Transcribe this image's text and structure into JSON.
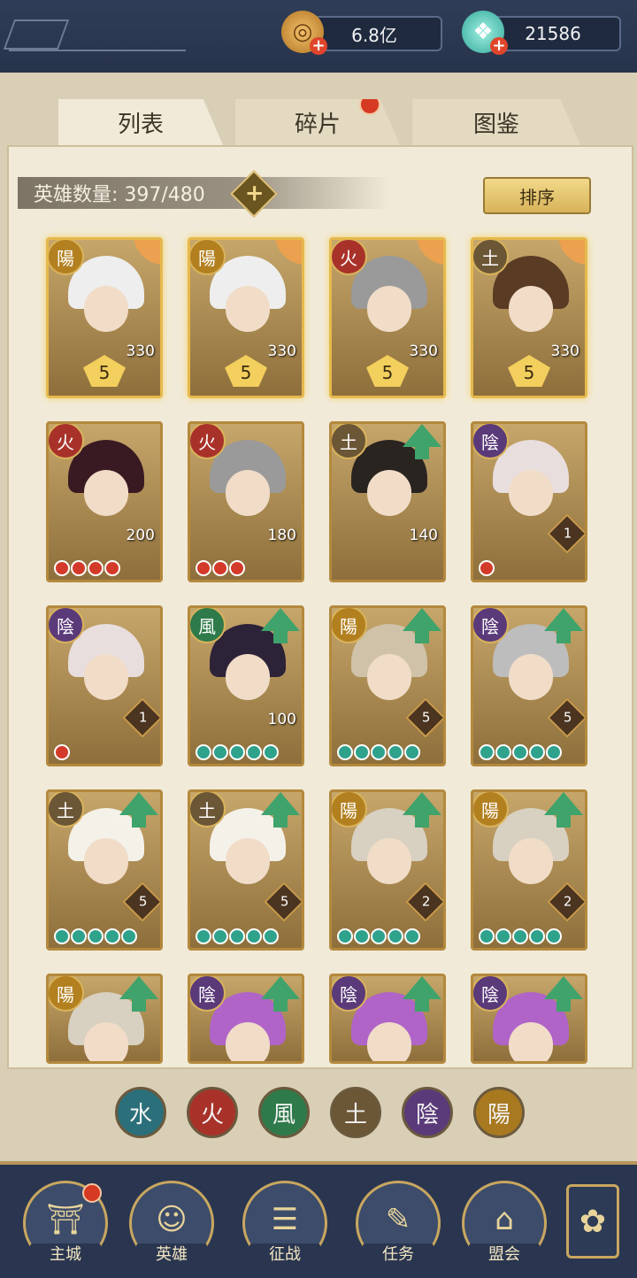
{
  "currency": {
    "coins": {
      "value": "6.8亿",
      "icon": "coin-icon"
    },
    "jade": {
      "value": "21586",
      "icon": "jade-pouch-icon"
    }
  },
  "tabs": [
    {
      "label": "列表",
      "active": true
    },
    {
      "label": "碎片",
      "active": false,
      "has_dot": true
    },
    {
      "label": "图鉴",
      "active": false
    }
  ],
  "hero_count": {
    "text": "英雄数量: 397/480"
  },
  "sort_button": "排序",
  "elements": {
    "yang": "陽",
    "fire": "火",
    "earth": "土",
    "yin": "陰",
    "wind": "風",
    "water": "水"
  },
  "cards": [
    {
      "element": "陽",
      "level": "330",
      "stars": "5",
      "rarity": "gold"
    },
    {
      "element": "陽",
      "level": "330",
      "stars": "5",
      "rarity": "gold"
    },
    {
      "element": "火",
      "level": "330",
      "stars": "5",
      "rarity": "gold"
    },
    {
      "element": "土",
      "level": "330",
      "stars": "5",
      "rarity": "gold"
    },
    {
      "element": "火",
      "level": "200",
      "beads": 4,
      "bead_color": "red"
    },
    {
      "element": "火",
      "level": "180",
      "beads": 3,
      "bead_color": "red"
    },
    {
      "element": "土",
      "level": "140",
      "upgrade": true
    },
    {
      "element": "陰",
      "level": "1",
      "beads": 1,
      "bead_color": "red",
      "diamond": true
    },
    {
      "element": "陰",
      "level": "1",
      "beads": 1,
      "bead_color": "red",
      "diamond": true
    },
    {
      "element": "風",
      "level": "100",
      "beads": 5,
      "bead_color": "green",
      "upgrade": true
    },
    {
      "element": "陽",
      "level": "5",
      "beads": 5,
      "bead_color": "green",
      "upgrade": true,
      "diamond": true
    },
    {
      "element": "陰",
      "level": "5",
      "beads": 5,
      "bead_color": "green",
      "upgrade": true,
      "diamond": true
    },
    {
      "element": "土",
      "level": "5",
      "beads": 5,
      "bead_color": "green",
      "upgrade": true,
      "diamond": true
    },
    {
      "element": "土",
      "level": "5",
      "beads": 5,
      "bead_color": "green",
      "upgrade": true,
      "diamond": true
    },
    {
      "element": "陽",
      "level": "2",
      "beads": 5,
      "bead_color": "green",
      "upgrade": true,
      "diamond": true
    },
    {
      "element": "陽",
      "level": "2",
      "beads": 5,
      "bead_color": "green",
      "upgrade": true,
      "diamond": true
    },
    {
      "element": "陽",
      "upgrade": true
    },
    {
      "element": "陰",
      "upgrade": true
    },
    {
      "element": "陰",
      "upgrade": true
    },
    {
      "element": "陰",
      "upgrade": true
    }
  ],
  "filters": [
    {
      "label": "水",
      "color": "#2a6f7a"
    },
    {
      "label": "火",
      "color": "#a8322a"
    },
    {
      "label": "風",
      "color": "#2f7a4a"
    },
    {
      "label": "土",
      "color": "#6b5636"
    },
    {
      "label": "陰",
      "color": "#5b3a7a"
    },
    {
      "label": "陽",
      "color": "#a8791f"
    }
  ],
  "nav": [
    {
      "label": "主城",
      "icon": "city-gate-icon",
      "has_dot": true
    },
    {
      "label": "英雄",
      "icon": "hero-portrait-icon"
    },
    {
      "label": "征战",
      "icon": "battle-scroll-icon"
    },
    {
      "label": "任务",
      "icon": "task-scroll-icon"
    },
    {
      "label": "盟会",
      "icon": "alliance-pavilion-icon"
    }
  ],
  "colors": {
    "accent_gold": "#e6b94d",
    "notification_red": "#d63a22",
    "upgrade_green": "#3fa36b"
  }
}
